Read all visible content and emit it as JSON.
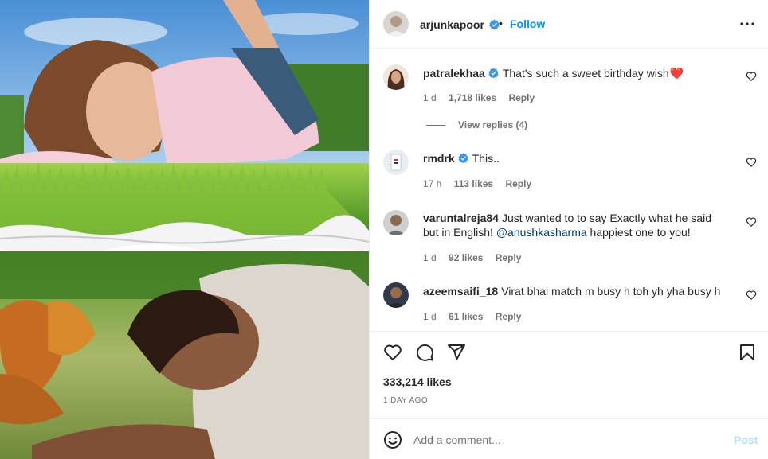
{
  "post": {
    "author": "arjunkapoor",
    "follow_label": "Follow",
    "separator": "•",
    "likes": "333,214 likes",
    "time_ago": "1 DAY AGO"
  },
  "comments": [
    {
      "username": "patralekhaa",
      "verified": true,
      "text": "That's such a sweet birthday wish",
      "emoji": "❤️",
      "time": "1 d",
      "likes": "1,718 likes",
      "reply_label": "Reply",
      "view_replies": "View replies (4)"
    },
    {
      "username": "rmdrk",
      "verified": true,
      "text": "This..",
      "time": "17 h",
      "likes": "113 likes",
      "reply_label": "Reply"
    },
    {
      "username": "varuntalreja84",
      "verified": false,
      "text_before": "Just wanted to to say Exactly what he said but in English! ",
      "mention": "@anushkasharma",
      "text_after": " happiest one to you!",
      "time": "1 d",
      "likes": "92 likes",
      "reply_label": "Reply"
    },
    {
      "username": "azeemsaifi_18",
      "verified": false,
      "text": "Virat bhai match m busy h toh yh yha busy h",
      "time": "1 d",
      "likes": "61 likes",
      "reply_label": "Reply"
    }
  ],
  "comment_box": {
    "placeholder": "Add a comment...",
    "post_label": "Post"
  },
  "icons": {
    "like": "heart-icon",
    "comment": "comment-icon",
    "share": "send-icon",
    "save": "bookmark-icon",
    "emoji": "smiley-icon",
    "more": "more-options-icon",
    "verified": "verified-badge-icon"
  },
  "colors": {
    "link_blue": "#0095f6",
    "verified_blue": "#3897f0",
    "post_disabled": "#b2dffc",
    "secondary_text": "#737373",
    "heart_red": "#ed4956"
  }
}
